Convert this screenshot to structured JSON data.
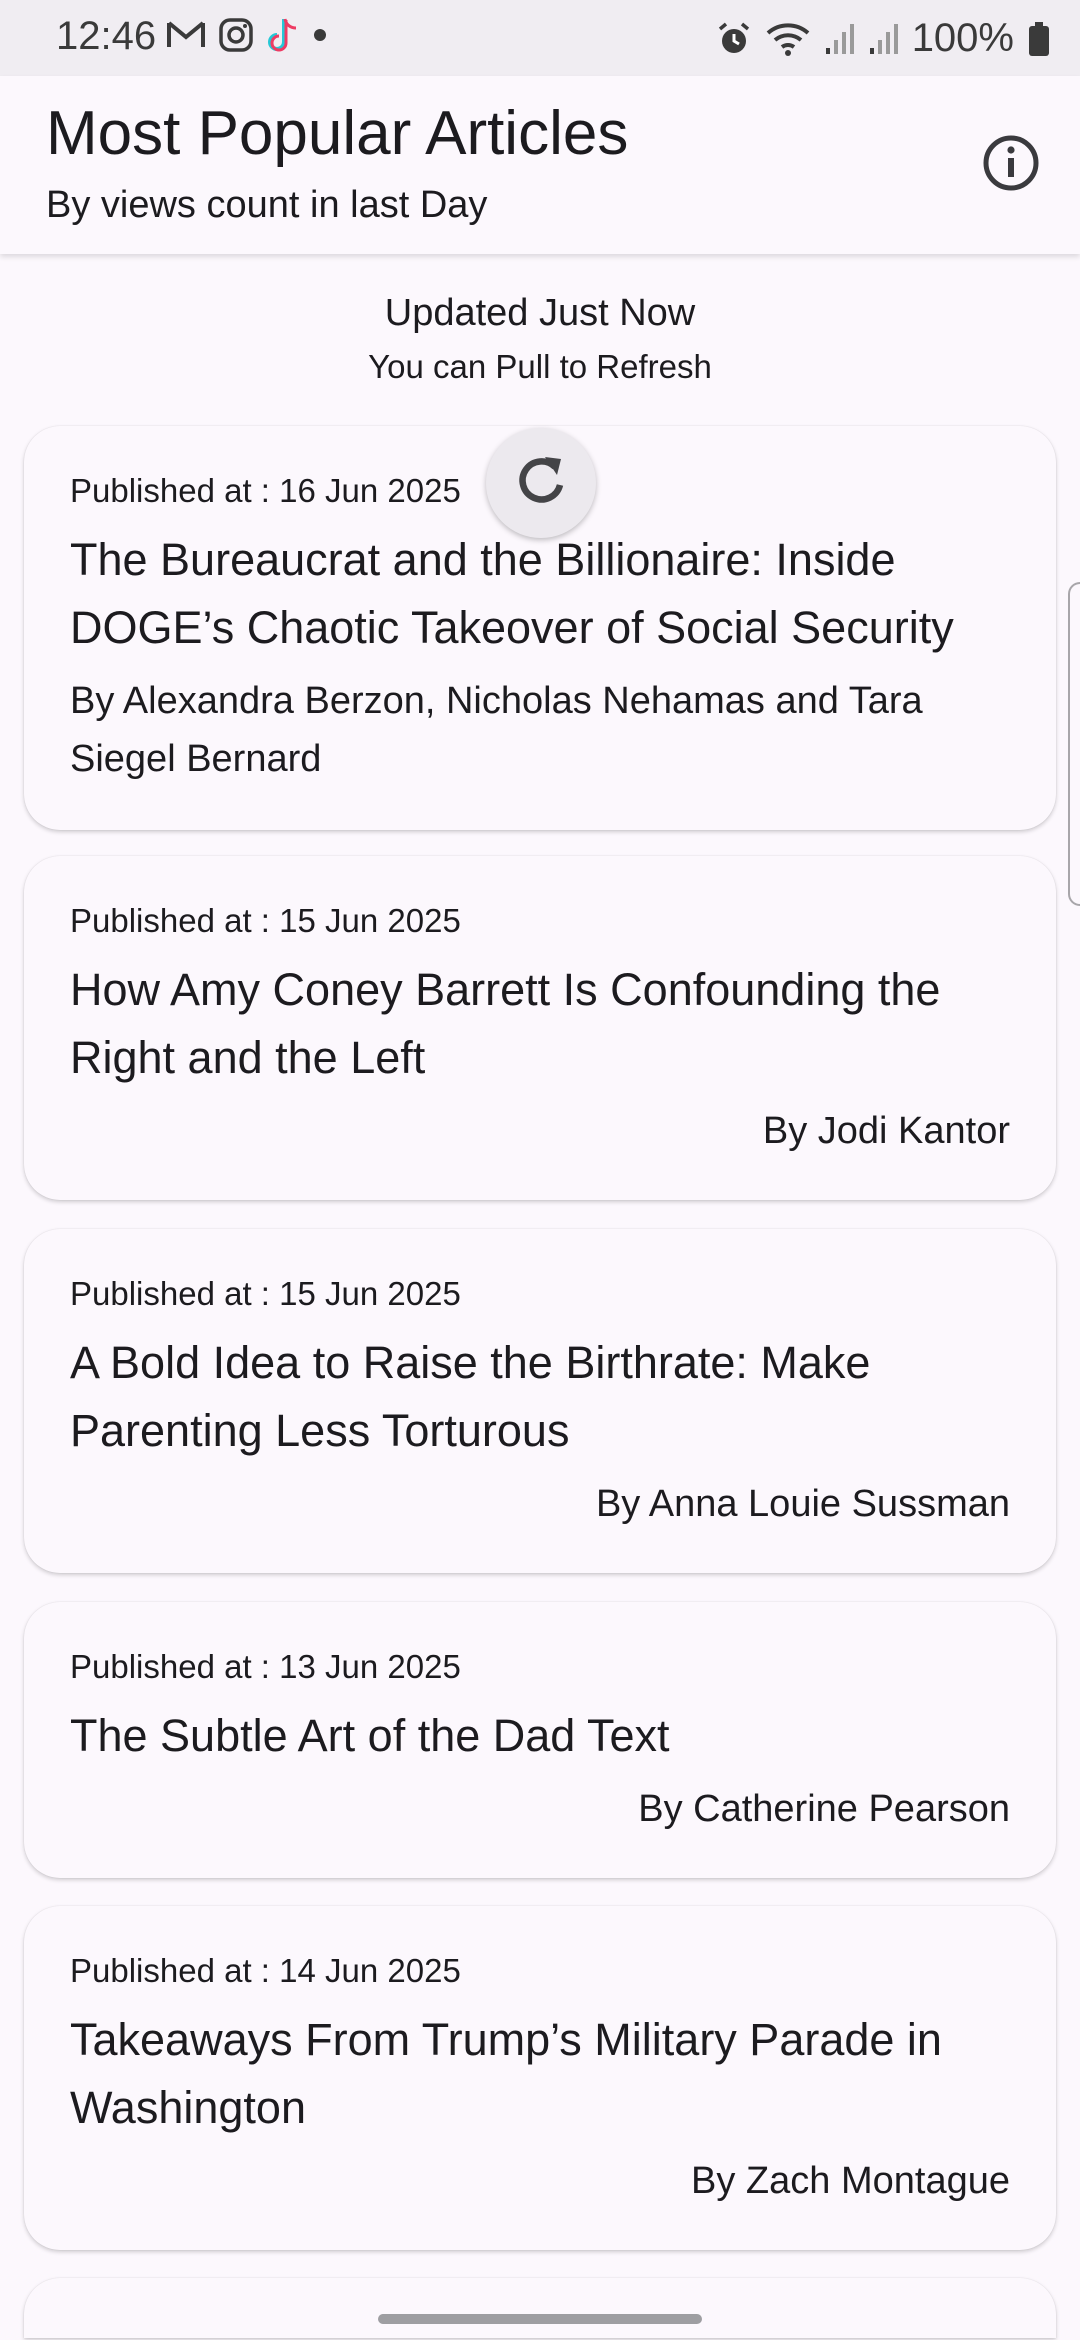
{
  "status_bar": {
    "time": "12:46",
    "battery": "100%",
    "left_icons": [
      "gmail-icon",
      "instagram-icon",
      "tiktok-icon",
      "dot-icon"
    ],
    "right_icons": [
      "alarm-icon",
      "wifi-icon",
      "signal-icon",
      "signal-icon",
      "battery-icon"
    ]
  },
  "app_bar": {
    "title": "Most Popular Articles",
    "subtitle": "By views count in last Day",
    "info_icon": "info-icon"
  },
  "refresh": {
    "status": "Updated Just Now",
    "hint": "You can Pull to Refresh",
    "spinner_icon": "refresh-icon"
  },
  "articles": [
    {
      "date": "Published at : 16 Jun 2025",
      "title": "The Bureaucrat and the Billionaire: Inside DOGE’s Chaotic Takeover of Social Security",
      "author": "By Alexandra Berzon, Nicholas Nehamas and Tara Siegel Bernard"
    },
    {
      "date": "Published at : 15 Jun 2025",
      "title": "How Amy Coney Barrett Is Confounding the Right and the Left",
      "author": "By Jodi Kantor"
    },
    {
      "date": "Published at : 15 Jun 2025",
      "title": "A Bold Idea to Raise the Birthrate: Make Parenting Less Torturous",
      "author": "By Anna Louie Sussman"
    },
    {
      "date": "Published at : 13 Jun 2025",
      "title": "The Subtle Art of the Dad Text",
      "author": "By Catherine Pearson"
    },
    {
      "date": "Published at : 14 Jun 2025",
      "title": "Takeaways From Trump’s Military Parade in Washington",
      "author": "By Zach Montague"
    }
  ]
}
